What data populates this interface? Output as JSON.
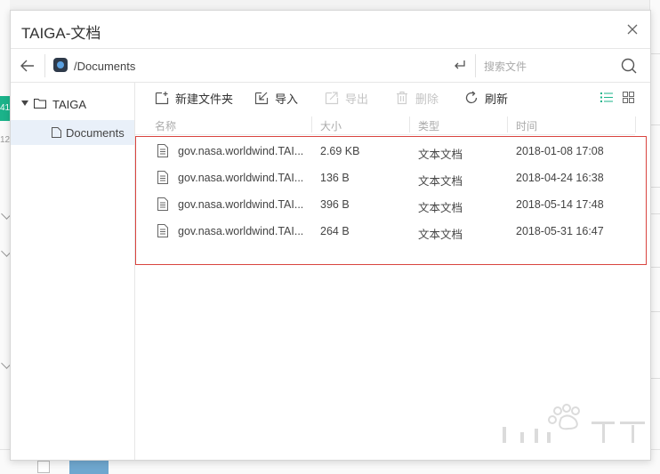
{
  "dialog": {
    "title": "TAIGA-文档",
    "path": "/Documents",
    "search_placeholder": "搜索文件"
  },
  "sidebar": {
    "root_label": "TAIGA",
    "child_label": "Documents"
  },
  "toolbar": {
    "new_folder": "新建文件夹",
    "import": "导入",
    "export": "导出",
    "delete": "删除",
    "refresh": "刷新"
  },
  "columns": {
    "name": "名称",
    "size": "大小",
    "type": "类型",
    "time": "时间"
  },
  "files": [
    {
      "name": "gov.nasa.worldwind.TAI...",
      "size": "2.69 KB",
      "type": "文本文档",
      "time": "2018-01-08 17:08"
    },
    {
      "name": "gov.nasa.worldwind.TAI...",
      "size": "136 B",
      "type": "文本文档",
      "time": "2018-04-24 16:38"
    },
    {
      "name": "gov.nasa.worldwind.TAI...",
      "size": "396 B",
      "type": "文本文档",
      "time": "2018-05-14 17:48"
    },
    {
      "name": "gov.nasa.worldwind.TAI...",
      "size": "264 B",
      "type": "文本文档",
      "time": "2018-05-31 16:47"
    }
  ],
  "background": {
    "left_tag": "41",
    "left_num": "12"
  },
  "colors": {
    "accent_green": "#1bb38a",
    "highlight_red": "#d9443f",
    "selected_bg": "#e9f0f9"
  },
  "watermark": "Baidu 经验"
}
